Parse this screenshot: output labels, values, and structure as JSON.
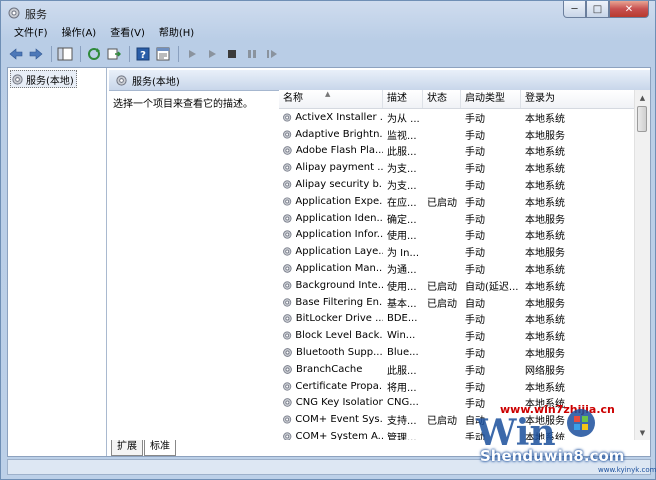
{
  "window": {
    "title": "服务",
    "min_label": "─",
    "max_label": "□",
    "close_label": "✕"
  },
  "menu": [
    "文件(F)",
    "操作(A)",
    "查看(V)",
    "帮助(H)"
  ],
  "tree": {
    "item_label": "服务(本地)"
  },
  "right_header": {
    "title": "服务(本地)"
  },
  "description_prompt": "选择一个项目来查看它的描述。",
  "columns": {
    "name": "名称",
    "desc": "描述",
    "status": "状态",
    "startup": "启动类型",
    "logon": "登录为"
  },
  "services": [
    {
      "name": "ActiveX Installer ...",
      "desc": "为从 ...",
      "status": "",
      "startup": "手动",
      "logon": "本地系统"
    },
    {
      "name": "Adaptive Brightn...",
      "desc": "监视...",
      "status": "",
      "startup": "手动",
      "logon": "本地服务"
    },
    {
      "name": "Adobe Flash Pla...",
      "desc": "此服...",
      "status": "",
      "startup": "手动",
      "logon": "本地系统"
    },
    {
      "name": "Alipay payment ...",
      "desc": "为支...",
      "status": "",
      "startup": "手动",
      "logon": "本地系统"
    },
    {
      "name": "Alipay security b...",
      "desc": "为支...",
      "status": "",
      "startup": "手动",
      "logon": "本地系统"
    },
    {
      "name": "Application Expe...",
      "desc": "在应...",
      "status": "已启动",
      "startup": "手动",
      "logon": "本地系统"
    },
    {
      "name": "Application Iden...",
      "desc": "确定...",
      "status": "",
      "startup": "手动",
      "logon": "本地服务"
    },
    {
      "name": "Application Infor...",
      "desc": "使用...",
      "status": "",
      "startup": "手动",
      "logon": "本地系统"
    },
    {
      "name": "Application Laye...",
      "desc": "为 In...",
      "status": "",
      "startup": "手动",
      "logon": "本地服务"
    },
    {
      "name": "Application Man...",
      "desc": "为通...",
      "status": "",
      "startup": "手动",
      "logon": "本地系统"
    },
    {
      "name": "Background Inte...",
      "desc": "使用...",
      "status": "已启动",
      "startup": "自动(延迟...",
      "logon": "本地系统"
    },
    {
      "name": "Base Filtering En...",
      "desc": "基本...",
      "status": "已启动",
      "startup": "自动",
      "logon": "本地服务"
    },
    {
      "name": "BitLocker Drive ...",
      "desc": "BDE...",
      "status": "",
      "startup": "手动",
      "logon": "本地系统"
    },
    {
      "name": "Block Level Back...",
      "desc": "Win...",
      "status": "",
      "startup": "手动",
      "logon": "本地系统"
    },
    {
      "name": "Bluetooth Supp...",
      "desc": "Blue...",
      "status": "",
      "startup": "手动",
      "logon": "本地服务"
    },
    {
      "name": "BranchCache",
      "desc": "此服...",
      "status": "",
      "startup": "手动",
      "logon": "网络服务"
    },
    {
      "name": "Certificate Propa...",
      "desc": "将用...",
      "status": "",
      "startup": "手动",
      "logon": "本地系统"
    },
    {
      "name": "CNG Key Isolation",
      "desc": "CNG...",
      "status": "",
      "startup": "手动",
      "logon": "本地系统"
    },
    {
      "name": "COM+ Event Sys...",
      "desc": "支持...",
      "status": "已启动",
      "startup": "自动",
      "logon": "本地服务"
    },
    {
      "name": "COM+ System A...",
      "desc": "管理...",
      "status": "",
      "startup": "手动",
      "logon": "本地系统"
    }
  ],
  "tabs": [
    "扩展",
    "标准"
  ],
  "watermark": {
    "site": "www.win7zhijia.cn",
    "logo": "Win",
    "brand": "Shenduwin8.com",
    "sub": "www.kyinyk.com"
  },
  "colors": {
    "accent": "#1b4f9c",
    "close": "#c75050",
    "watermark_red": "#cc0000"
  }
}
